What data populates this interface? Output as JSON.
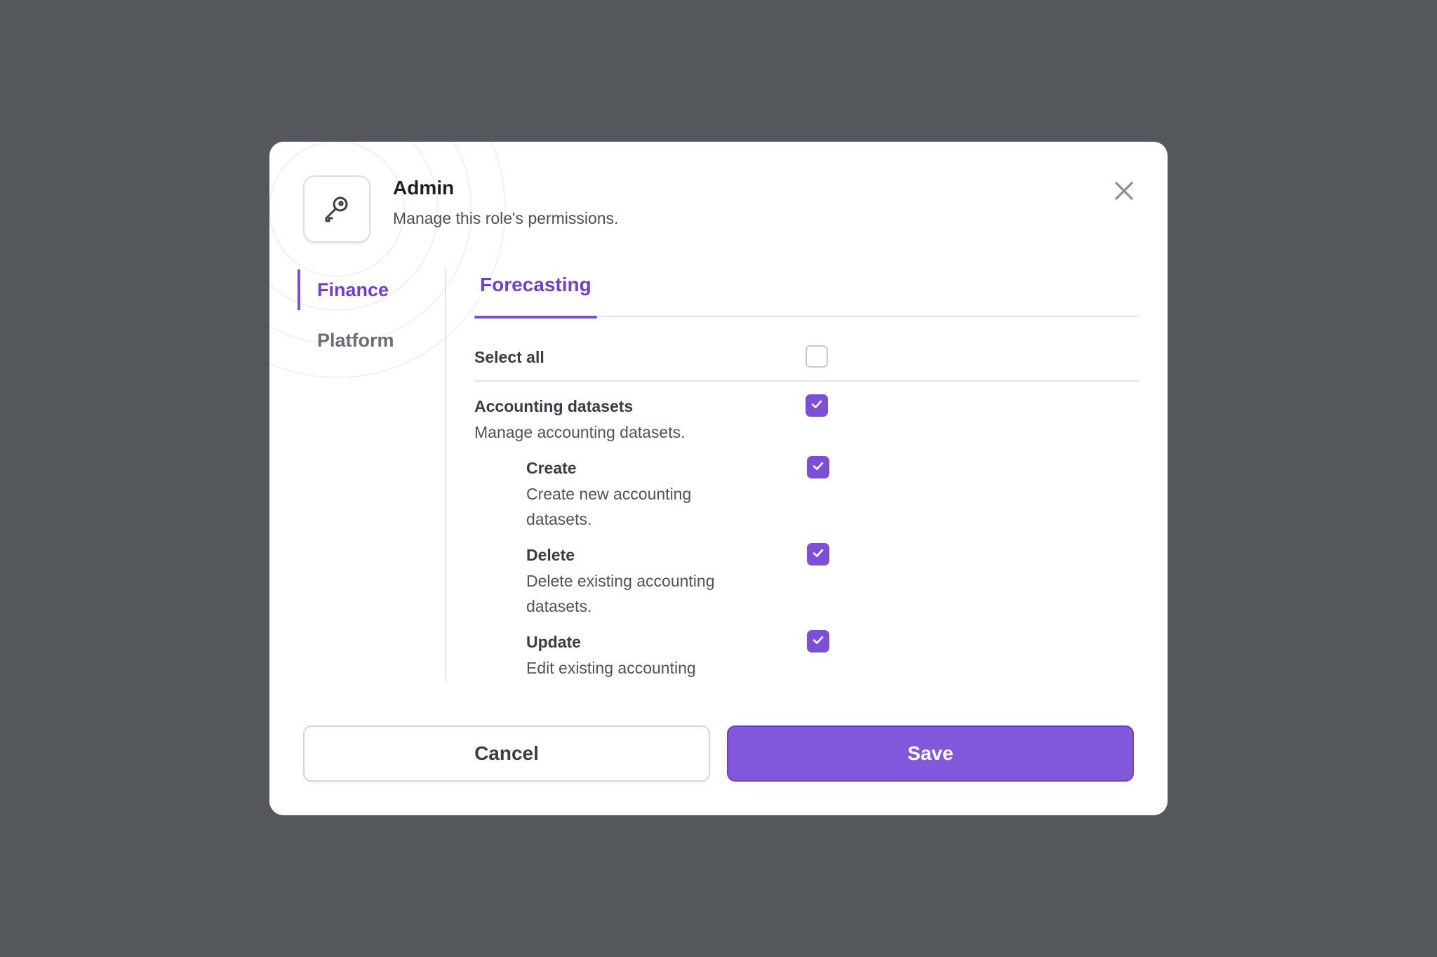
{
  "dialog": {
    "title": "Admin",
    "subtitle": "Manage this role's permissions.",
    "icon": "key-icon",
    "close_icon": "close-icon"
  },
  "sidebar": {
    "items": [
      {
        "label": "Finance",
        "active": true
      },
      {
        "label": "Platform",
        "active": false
      }
    ]
  },
  "tabs": [
    {
      "label": "Forecasting",
      "active": true
    }
  ],
  "permissions": {
    "select_all": {
      "label": "Select all",
      "checked": false
    },
    "group": {
      "name": "Accounting datasets",
      "description": "Manage accounting datasets.",
      "checked": true
    },
    "items": [
      {
        "name": "Create",
        "description": "Create new accounting datasets.",
        "checked": true
      },
      {
        "name": "Delete",
        "description": "Delete existing accounting datasets.",
        "checked": true
      },
      {
        "name": "Update",
        "description": "Edit existing accounting datasets.",
        "checked": true
      }
    ]
  },
  "footer": {
    "cancel_label": "Cancel",
    "save_label": "Save"
  },
  "colors": {
    "accent": "#7b4fd8",
    "backdrop": "#54585c"
  }
}
